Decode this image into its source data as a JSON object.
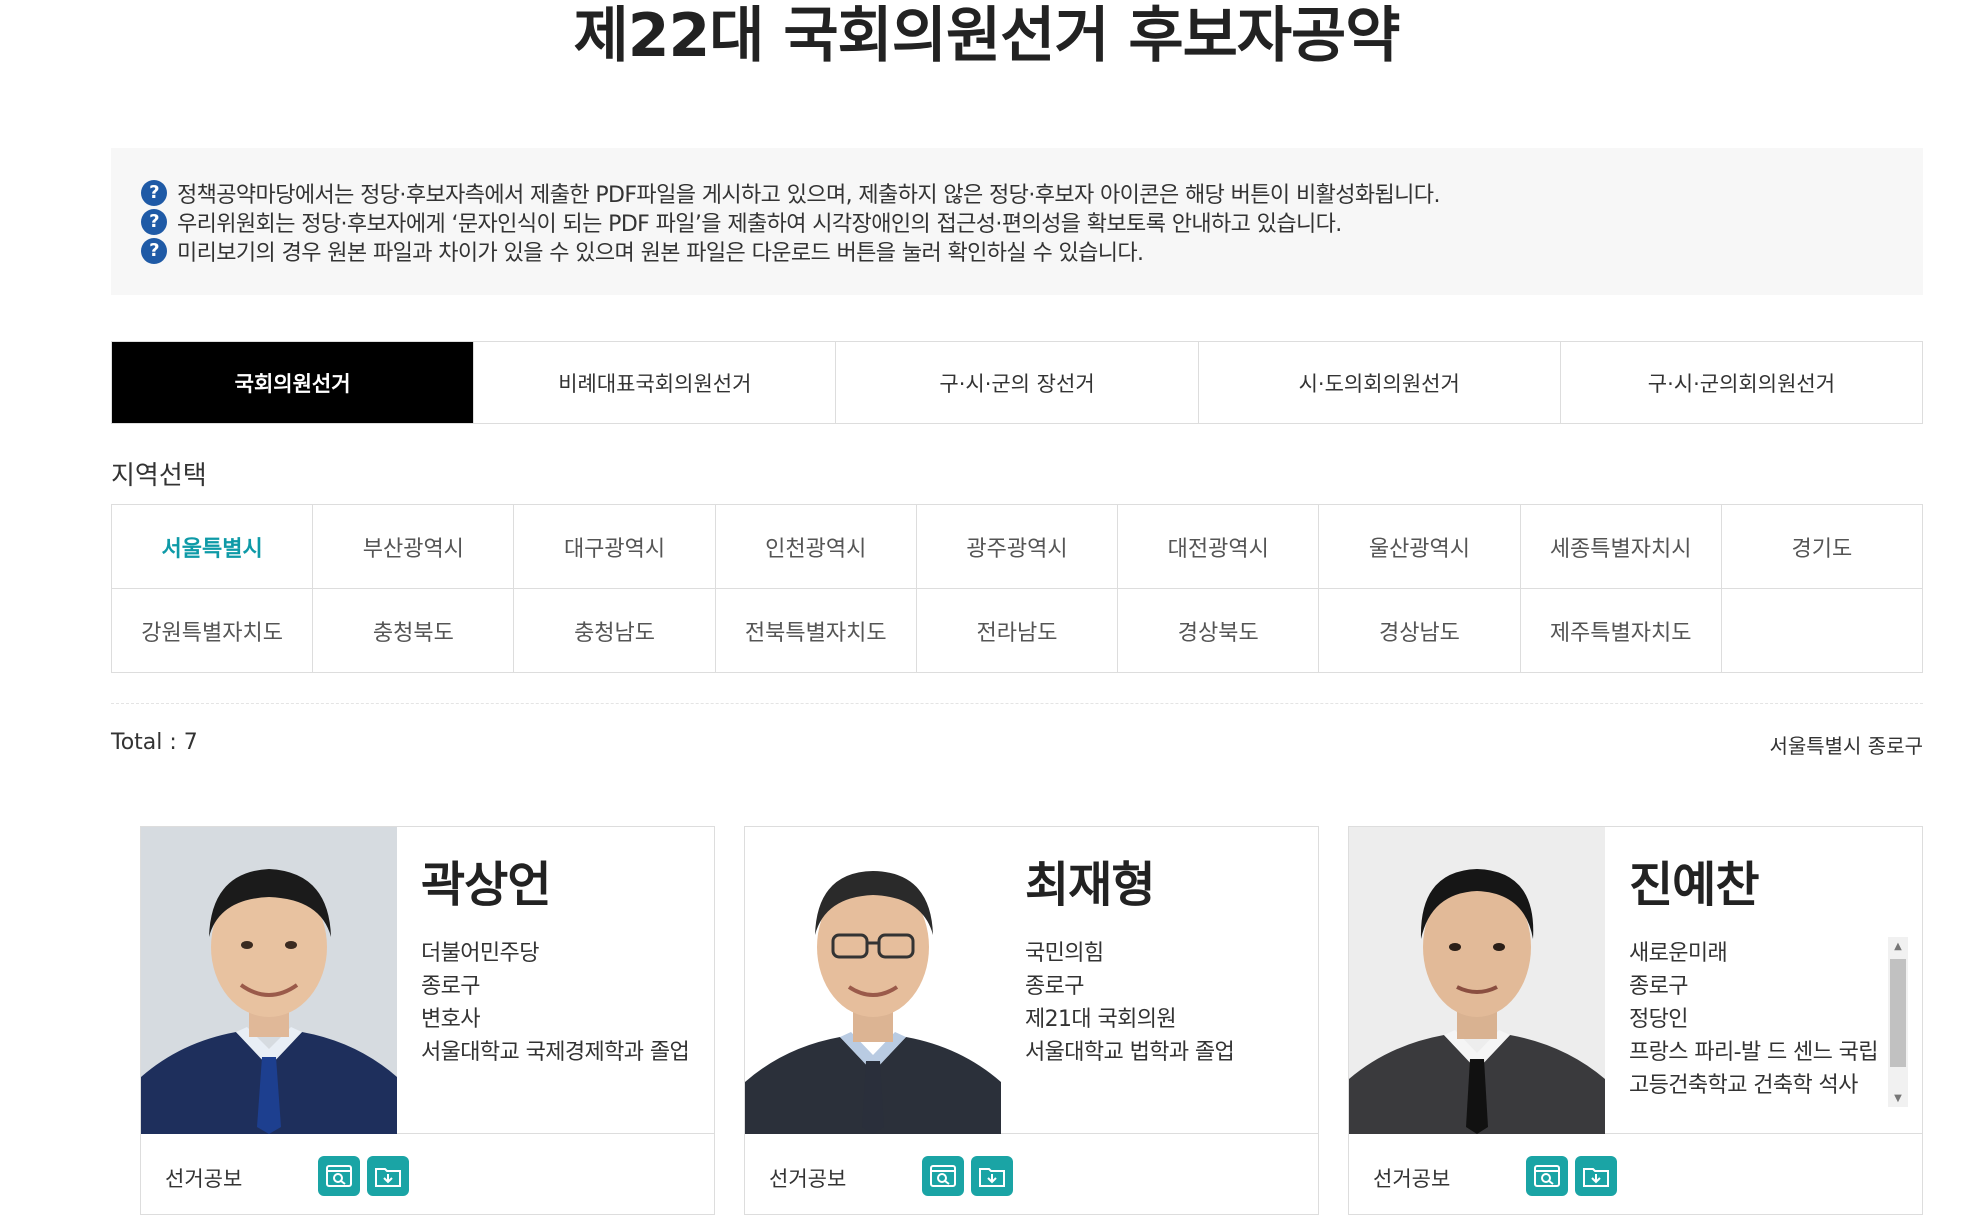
{
  "page": {
    "title": "제22대 국회의원선거 후보자공약"
  },
  "notices": [
    "정책공약마당에서는 정당·후보자측에서 제출한 PDF파일을 게시하고 있으며, 제출하지 않은 정당·후보자 아이콘은 해당 버튼이 비활성화됩니다.",
    "우리위원회는 정당·후보자에게 ‘문자인식이 되는 PDF 파일’을 제출하여 시각장애인의 접근성·편의성을 확보토록 안내하고 있습니다.",
    "미리보기의 경우 원본 파일과 차이가 있을 수 있으며 원본 파일은 다운로드 버튼을 눌러 확인하실 수 있습니다."
  ],
  "notice_icon": "question-circle-icon",
  "tabs": [
    {
      "label": "국회의원선거",
      "active": true
    },
    {
      "label": "비례대표국회의원선거",
      "active": false
    },
    {
      "label": "구·시·군의 장선거",
      "active": false
    },
    {
      "label": "시·도의회의원선거",
      "active": false
    },
    {
      "label": "구·시·군의회의원선거",
      "active": false
    }
  ],
  "region_heading": "지역선택",
  "regions": [
    {
      "label": "서울특별시",
      "active": true
    },
    {
      "label": "부산광역시"
    },
    {
      "label": "대구광역시"
    },
    {
      "label": "인천광역시"
    },
    {
      "label": "광주광역시"
    },
    {
      "label": "대전광역시"
    },
    {
      "label": "울산광역시"
    },
    {
      "label": "세종특별자치시"
    },
    {
      "label": "경기도"
    },
    {
      "label": "강원특별자치도"
    },
    {
      "label": "충청북도"
    },
    {
      "label": "충청남도"
    },
    {
      "label": "전북특별자치도"
    },
    {
      "label": "전라남도"
    },
    {
      "label": "경상북도"
    },
    {
      "label": "경상남도"
    },
    {
      "label": "제주특별자치도"
    }
  ],
  "result": {
    "total_label": "Total : ",
    "total": "7",
    "location": "서울특별시 종로구"
  },
  "candidates": [
    {
      "name": "곽상언",
      "details": [
        "더불어민주당",
        "종로구",
        "변호사",
        "서울대학교 국제경제학과 졸업"
      ],
      "footer_label": "선거공보",
      "tie_color": "#1d3f8f"
    },
    {
      "name": "최재형",
      "details": [
        "국민의힘",
        "종로구",
        "제21대 국회의원",
        "서울대학교 법학과 졸업"
      ],
      "footer_label": "선거공보",
      "tie_color": "#2a2f3b"
    },
    {
      "name": "진예찬",
      "details": [
        "새로운미래",
        "종로구",
        "정당인",
        "프랑스 파리-발 드 센느 국립고등건축학교 건축학 석사"
      ],
      "footer_label": "선거공보",
      "tie_color": "#111111"
    }
  ],
  "icons": {
    "preview": "preview-search-icon",
    "download": "download-icon",
    "scroll_up": "scroll-up-icon",
    "scroll_down": "scroll-down-icon"
  },
  "colors": {
    "accent": "#1aa4a5",
    "active_region": "#0e9aa7",
    "notice_icon": "#1f5aa6",
    "active_tab_bg": "#000000"
  }
}
